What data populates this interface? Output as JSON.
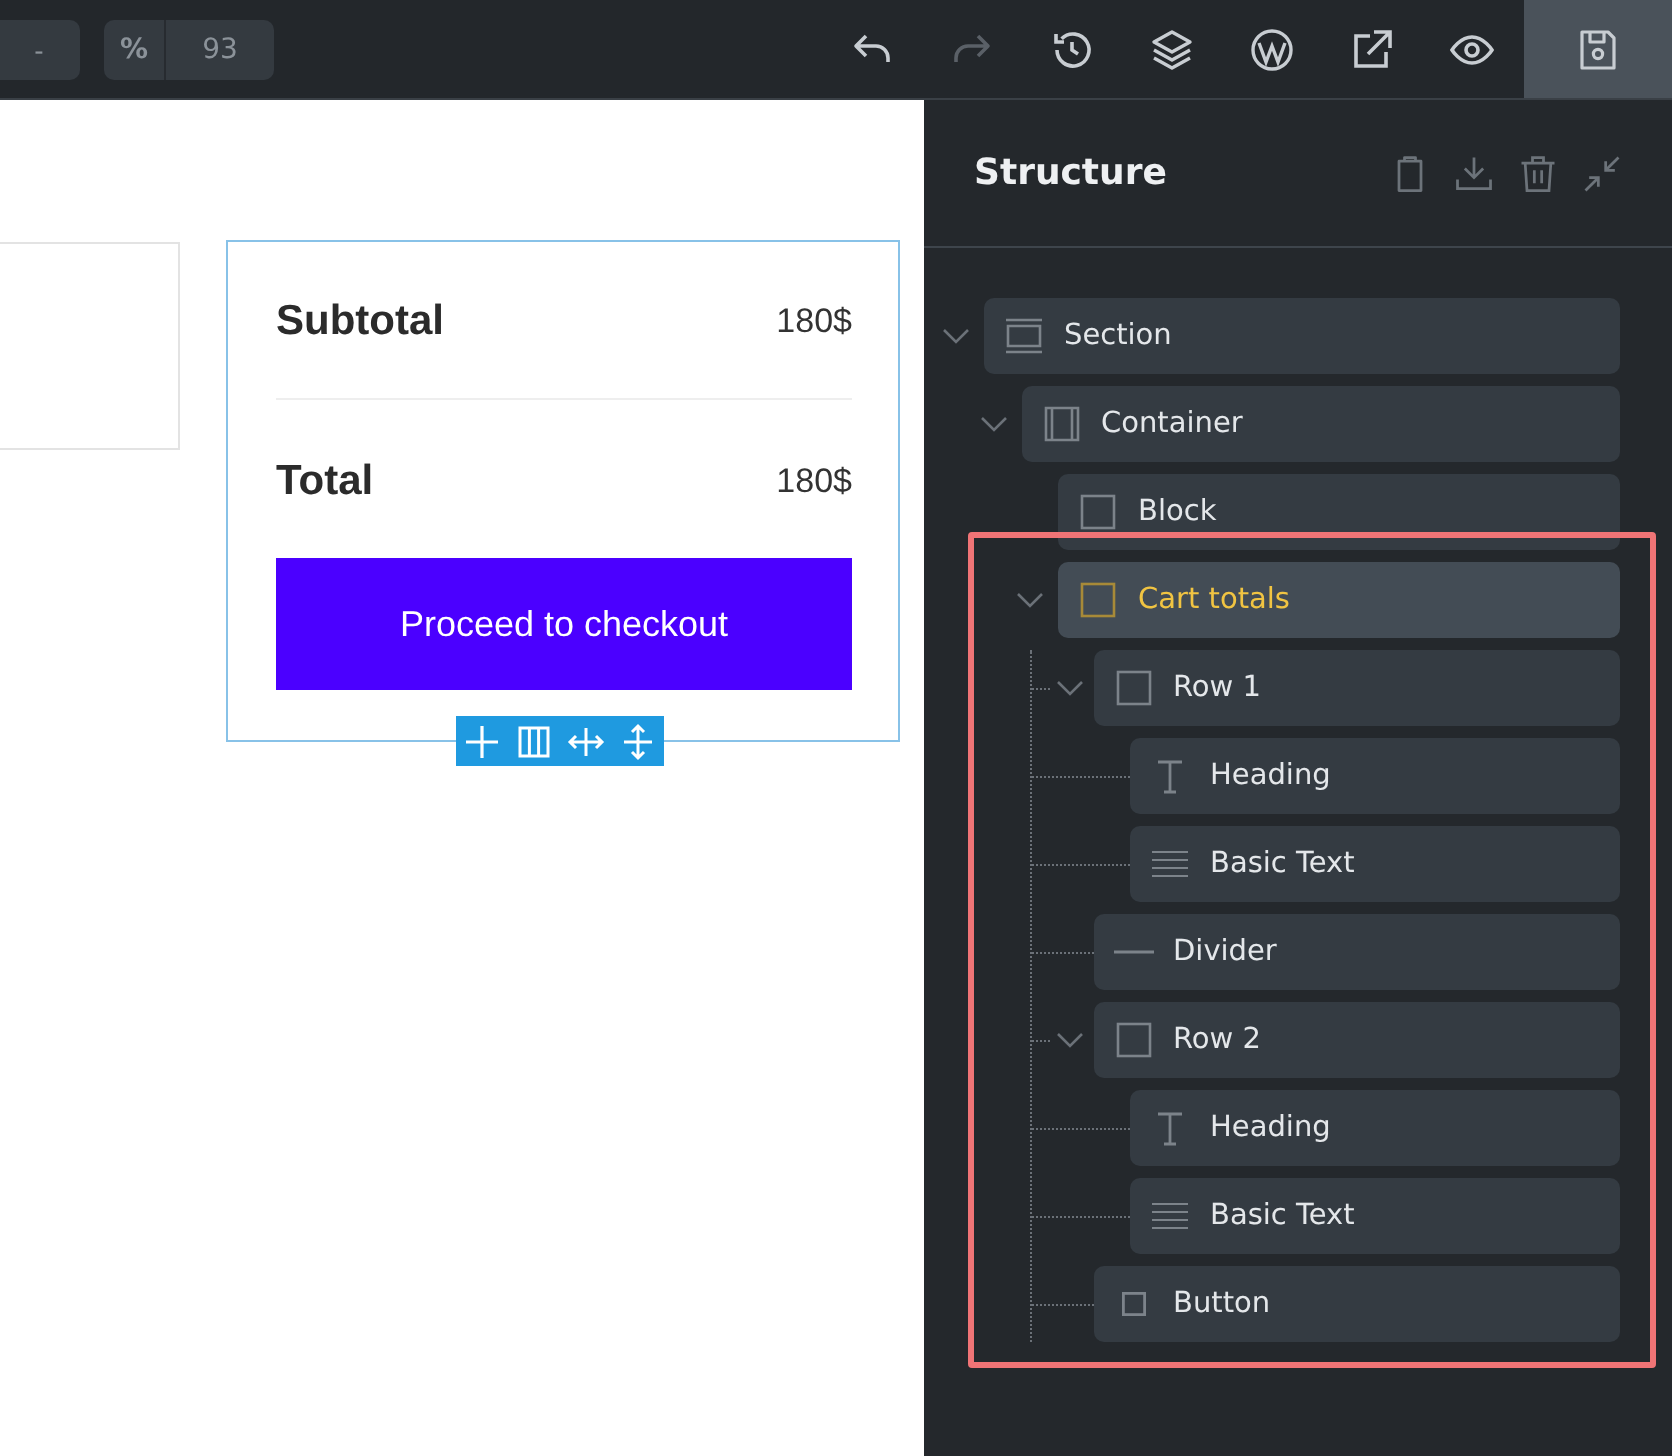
{
  "topbar": {
    "zoom_out": "-",
    "zoom_unit": "%",
    "zoom": "93",
    "actions": [
      {
        "kind": "undo",
        "disabled": false
      },
      {
        "kind": "redo",
        "disabled": true
      },
      {
        "kind": "history",
        "disabled": false
      },
      {
        "kind": "layers",
        "disabled": false
      },
      {
        "kind": "wordpress",
        "disabled": false
      },
      {
        "kind": "external",
        "disabled": false
      },
      {
        "kind": "preview",
        "disabled": false
      }
    ],
    "save": {
      "kind": "save"
    }
  },
  "canvas": {
    "totals": [
      {
        "label": "Subtotal",
        "value": "180$"
      },
      {
        "label": "Total",
        "value": "180$"
      }
    ],
    "checkout": "Proceed to checkout"
  },
  "structure": {
    "title": "Structure",
    "tools": [
      {
        "kind": "clipboard"
      },
      {
        "kind": "download"
      },
      {
        "kind": "trash"
      },
      {
        "kind": "collapse"
      }
    ],
    "tree": [
      {
        "label": "Section",
        "kind": "section",
        "expanded": true,
        "selected": false,
        "children": [
          {
            "label": "Container",
            "kind": "container",
            "expanded": true,
            "selected": false,
            "children": [
              {
                "label": "Block",
                "kind": "block",
                "selected": false
              },
              {
                "label": "Cart totals",
                "kind": "block",
                "expanded": true,
                "selected": true,
                "highlighted": true,
                "children": [
                  {
                    "label": "Row 1",
                    "kind": "block",
                    "expanded": true,
                    "selected": false,
                    "children": [
                      {
                        "label": "Heading",
                        "kind": "heading",
                        "selected": false
                      },
                      {
                        "label": "Basic Text",
                        "kind": "text",
                        "selected": false
                      }
                    ]
                  },
                  {
                    "label": "Divider",
                    "kind": "divider",
                    "selected": false
                  },
                  {
                    "label": "Row 2",
                    "kind": "block",
                    "expanded": true,
                    "selected": false,
                    "children": [
                      {
                        "label": "Heading",
                        "kind": "heading",
                        "selected": false
                      },
                      {
                        "label": "Basic Text",
                        "kind": "text",
                        "selected": false
                      }
                    ]
                  },
                  {
                    "label": "Button",
                    "kind": "button",
                    "selected": false
                  }
                ]
              }
            ]
          }
        ]
      }
    ]
  }
}
